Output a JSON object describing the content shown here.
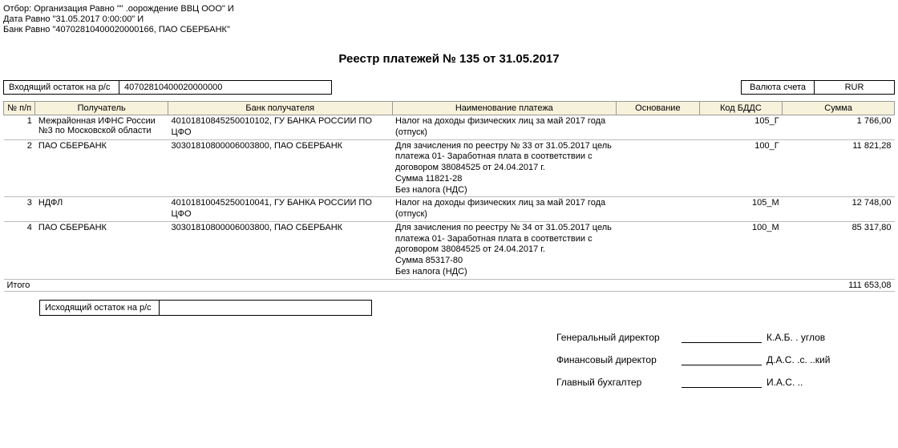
{
  "filters": {
    "line1": "Отбор: Организация Равно \"\"  .оорождение ВВЦ  ООО\" И",
    "line2": "Дата Равно \"31.05.2017 0:00:00\" И",
    "line3": "Банк Равно \"40702810400020000166, ПАО СБЕРБАНК\""
  },
  "title": "Реестр платежей № 135 от 31.05.2017",
  "incoming": {
    "label": "Входящий остаток на р/с",
    "value": "40702810400020000000"
  },
  "currency": {
    "label": "Валюта счета",
    "value": "RUR"
  },
  "headers": {
    "no": "№ п/п",
    "recipient": "Получатель",
    "bank": "Банк получателя",
    "desc": "Наименование платежа",
    "basis": "Основание",
    "code": "Код БДДС",
    "sum": "Сумма"
  },
  "rows": [
    {
      "no": "1",
      "recipient": "Межрайонная ИФНС России №3 по Московской области",
      "bank": "40101810845250010102, ГУ БАНКА РОССИИ ПО ЦФО",
      "desc": "Налог на доходы физических лиц за май 2017 года (отпуск)",
      "basis": "",
      "code": "105_Г",
      "sum": "1 766,00"
    },
    {
      "no": "2",
      "recipient": "ПАО СБЕРБАНК",
      "bank": "30301810800006003800, ПАО СБЕРБАНК",
      "desc": "Для зачисления по реестру № 33 от 31.05.2017 цель платежа 01- Заработная плата в соответствии с договором 38084525 от 24.04.2017 г.\nСумма 11821-28\nБез налога (НДС)",
      "basis": "",
      "code": "100_Г",
      "sum": "11 821,28"
    },
    {
      "no": "3",
      "recipient": "НДФЛ",
      "bank": "40101810045250010041, ГУ БАНКА РОССИИ ПО ЦФО",
      "desc": "Налог на доходы физических лиц за май 2017 года (отпуск)",
      "basis": "",
      "code": "105_М",
      "sum": "12 748,00"
    },
    {
      "no": "4",
      "recipient": "ПАО СБЕРБАНК",
      "bank": "30301810800006003800, ПАО СБЕРБАНК",
      "desc": "Для зачисления по реестру № 34 от 31.05.2017 цель платежа 01- Заработная плата в соответствии с договором 38084525 от 24.04.2017 г.\nСумма 85317-80\nБез налога (НДС)",
      "basis": "",
      "code": "100_М",
      "sum": "85 317,80"
    }
  ],
  "total": {
    "label": "Итого",
    "sum": "111 653,08"
  },
  "outgoing": {
    "label": "Исходящий остаток на р/с",
    "value": ""
  },
  "signatures": [
    {
      "title": "Генеральный директор",
      "name": "К.А.Б. . углов"
    },
    {
      "title": "Финансовый директор",
      "name": "Д.А.С. .с. ..кий"
    },
    {
      "title": "Главный бухгалтер",
      "name": "И.А.С.     .."
    }
  ]
}
